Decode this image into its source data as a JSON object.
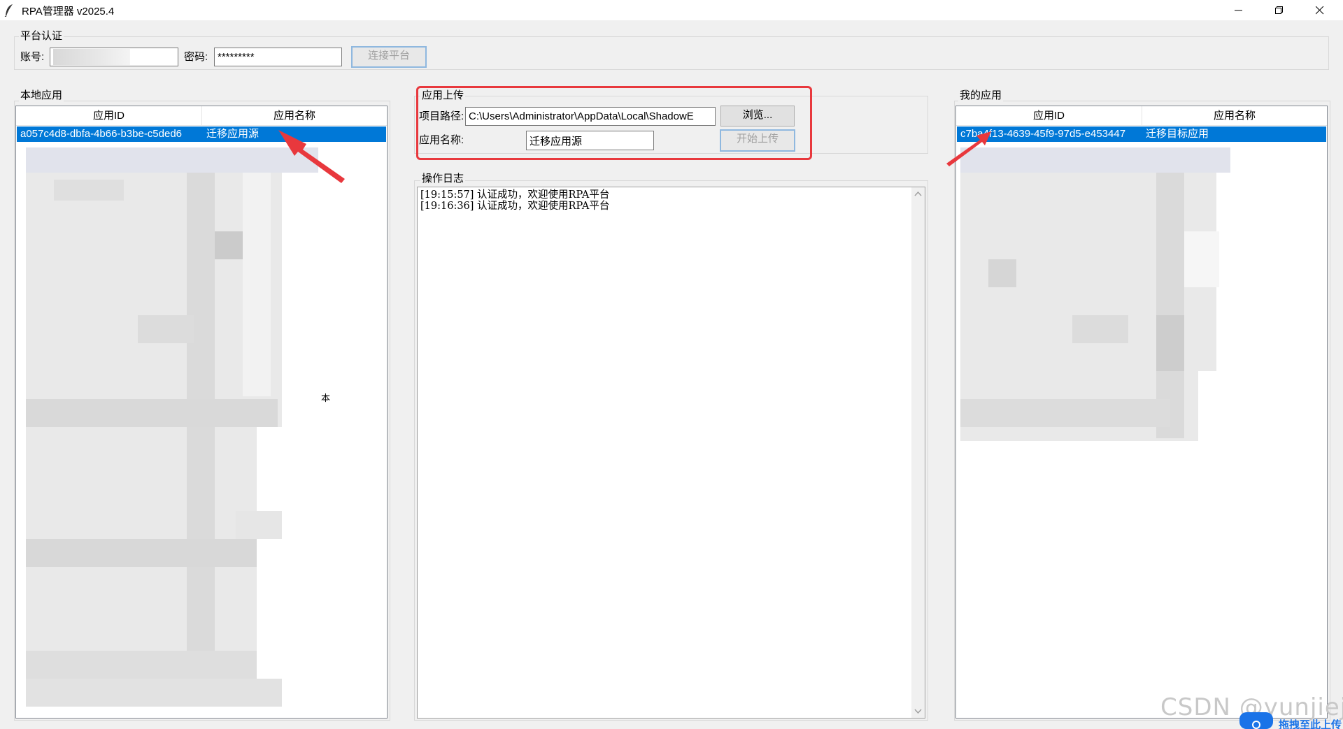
{
  "window": {
    "title": "RPA管理器 v2025.4"
  },
  "auth": {
    "group_label": "平台认证",
    "account_label": "账号:",
    "account_value": "",
    "password_label": "密码:",
    "password_value": "*********",
    "connect_button": "连接平台"
  },
  "local_apps": {
    "group_label": "本地应用",
    "columns": [
      "应用ID",
      "应用名称"
    ],
    "rows": [
      {
        "id": "a057c4d8-dbfa-4b66-b3be-c5ded6",
        "name": "迁移应用源"
      }
    ],
    "stray_text": "本"
  },
  "upload": {
    "group_label": "应用上传",
    "path_label": "项目路径:",
    "path_value": "C:\\Users\\Administrator\\AppData\\Local\\ShadowE",
    "browse_button": "浏览...",
    "name_label": "应用名称:",
    "name_value": "迁移应用源",
    "start_button": "开始上传"
  },
  "log": {
    "group_label": "操作日志",
    "lines": [
      "[19:15:57] 认证成功，欢迎使用RPA平台",
      "[19:16:36] 认证成功，欢迎使用RPA平台"
    ]
  },
  "my_apps": {
    "group_label": "我的应用",
    "columns": [
      "应用ID",
      "应用名称"
    ],
    "rows": [
      {
        "id": "c7ba4f13-4639-45f9-97d5-e453447",
        "name": "迁移目标应用"
      }
    ]
  },
  "overlay": {
    "watermark": "CSDN @yunjiejii",
    "upload_badge": "拖拽至此上传"
  },
  "colors": {
    "selection": "#0078d7",
    "annotation_red": "#e8383d",
    "window_bg": "#f0f0f0"
  }
}
